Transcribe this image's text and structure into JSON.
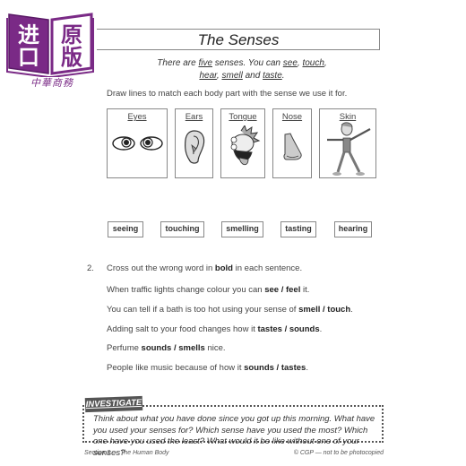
{
  "logo": {
    "chars": [
      "进",
      "口",
      "原",
      "版"
    ],
    "brand": "中華商務",
    "color": "#7a2a86"
  },
  "header": {
    "title": "The Senses",
    "intro_parts": [
      {
        "t": "There are ",
        "u": false
      },
      {
        "t": "five",
        "u": true
      },
      {
        "t": " senses.  You can ",
        "u": false
      },
      {
        "t": "see",
        "u": true
      },
      {
        "t": ", ",
        "u": false
      },
      {
        "t": "touch",
        "u": true
      },
      {
        "t": ",",
        "u": false
      },
      {
        "t": "hear",
        "u": true
      },
      {
        "t": ", ",
        "u": false
      },
      {
        "t": "smell",
        "u": true
      },
      {
        "t": " and ",
        "u": false
      },
      {
        "t": "taste",
        "u": true
      },
      {
        "t": ".",
        "u": false
      }
    ]
  },
  "question1": {
    "instruction": "Draw lines to match each body part with the sense we use it for.",
    "body_parts": [
      {
        "label": "Eyes",
        "icon": "eyes-icon"
      },
      {
        "label": "Ears",
        "icon": "ear-icon"
      },
      {
        "label": "Tongue",
        "icon": "tongue-face-icon"
      },
      {
        "label": "Nose",
        "icon": "nose-icon"
      },
      {
        "label": "Skin",
        "icon": "skin-figure-icon"
      }
    ],
    "senses": [
      "seeing",
      "touching",
      "smelling",
      "tasting",
      "hearing"
    ]
  },
  "question2": {
    "number": "2.",
    "instruction_pre": "Cross out the wrong word in ",
    "instruction_bold": "bold",
    "instruction_post": " in each sentence.",
    "sentences": [
      {
        "pre": "When traffic lights change colour you can ",
        "bold": "see / feel",
        "post": " it."
      },
      {
        "pre": "You can tell if a bath is too hot using your sense of ",
        "bold": "smell / touch",
        "post": "."
      },
      {
        "pre": "Adding salt to your food changes how it ",
        "bold": "tastes / sounds",
        "post": "."
      },
      {
        "pre": "Perfume ",
        "bold": "sounds / smells",
        "post": " nice."
      },
      {
        "pre": "People like music because of how it ",
        "bold": "sounds / tastes",
        "post": "."
      }
    ]
  },
  "investigate": {
    "tag": "INVESTIGATE",
    "text": "Think about what you have done since you got up this morning.  What have you used your senses for?  Which sense have you used the most?  Which one have you used the least?  What would it be like without one of your senses?"
  },
  "footer": {
    "left": "Section 2 — The Human Body",
    "right": "© CGP — not to be photocopied"
  }
}
